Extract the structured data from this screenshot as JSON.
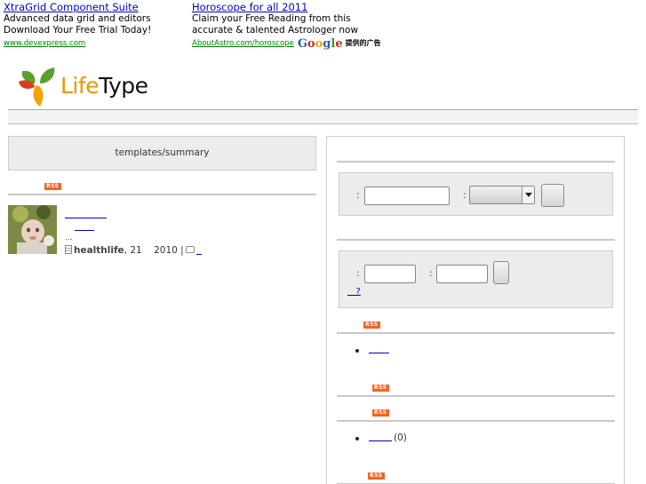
{
  "ads": [
    {
      "title": "XtraGrid Component Suite",
      "line1": "Advanced data grid and editors",
      "line2": "Download Your Free Trial Today!",
      "url": "www.devexpress.com"
    },
    {
      "title": "Horoscope for all 2011",
      "line1": "Claim your Free Reading from this",
      "line2": "accurate & talented Astrologer now",
      "url": "AboutAstro.com/horoscope"
    }
  ],
  "ads_by": {
    "google": "Google",
    "label": "提供的广告"
  },
  "logo": {
    "life": "Life",
    "type": "Type"
  },
  "colors": {
    "logo_orange": "#f29400",
    "logo_green": "#5aa02c",
    "logo_red": "#e03a1e",
    "rss_orange": "#f26522",
    "link_blue": "#0000cc",
    "ad_url_green": "#008000"
  },
  "left": {
    "summary_template": "templates/summary",
    "rss_badge": "RSS",
    "post": {
      "avatar_icon": "user-avatar",
      "ellipsis": "...",
      "author": "healthlife",
      "date_prefix": ", 21",
      "date_year": "2010 |",
      "document_icon": "document-icon",
      "comment_icon": "comment-icon"
    }
  },
  "right": {
    "search_form": {
      "colon1": ":",
      "colon2": ":"
    },
    "login_form": {
      "colon1": ":",
      "colon2": ":",
      "forgot_link": "?"
    },
    "rss_badge": "RSS",
    "category_count": "(0)"
  }
}
